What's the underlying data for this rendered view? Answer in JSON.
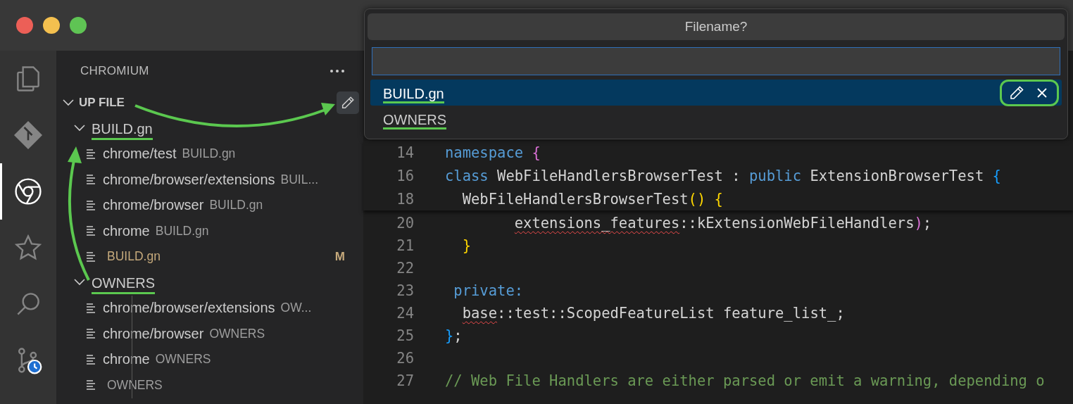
{
  "activity_bar": {
    "items": [
      {
        "kind": "files",
        "selected": false
      },
      {
        "kind": "git",
        "selected": false
      },
      {
        "kind": "chrome",
        "selected": true
      },
      {
        "kind": "star",
        "selected": false
      },
      {
        "kind": "search",
        "selected": false
      },
      {
        "kind": "history",
        "selected": false
      }
    ]
  },
  "sidebar": {
    "title": "CHROMIUM",
    "section": {
      "title": "UP FILE",
      "expanded": true
    },
    "groups": [
      {
        "label": "BUILD.gn",
        "expanded": true,
        "highlighted": true,
        "children": [
          {
            "name": "chrome/test",
            "description": "BUILD.gn"
          },
          {
            "name": "chrome/browser/extensions",
            "description": "BUIL..."
          },
          {
            "name": "chrome/browser",
            "description": "BUILD.gn"
          },
          {
            "name": "chrome",
            "description": "BUILD.gn"
          },
          {
            "description": "BUILD.gn",
            "status": "M"
          }
        ]
      },
      {
        "label": "OWNERS",
        "expanded": true,
        "highlighted": true,
        "children": [
          {
            "name": "chrome/browser/extensions",
            "description": "OW..."
          },
          {
            "name": "chrome/browser",
            "description": "OWNERS"
          },
          {
            "name": "chrome",
            "description": "OWNERS"
          },
          {
            "description": "OWNERS"
          }
        ]
      }
    ]
  },
  "quick_pick": {
    "title": "Filename?",
    "items": [
      {
        "label": "BUILD.gn",
        "selected": true,
        "highlighted": true
      },
      {
        "label": "OWNERS",
        "selected": false,
        "highlighted": true
      }
    ]
  },
  "editor": {
    "sticky_lines": [
      {
        "number": "14",
        "tokens": [
          {
            "kind": "keyword",
            "text": "namespace "
          },
          {
            "kind": "bracket2",
            "text": "{"
          }
        ]
      },
      {
        "number": "16",
        "tokens": [
          {
            "kind": "keyword",
            "text": "class "
          },
          {
            "kind": "plain",
            "text": "WebFileHandlersBrowserTest : "
          },
          {
            "kind": "keyword",
            "text": "public "
          },
          {
            "kind": "plain",
            "text": "ExtensionBrowserTest "
          },
          {
            "kind": "bracket3",
            "text": "{"
          }
        ]
      },
      {
        "number": "18",
        "tokens": [
          {
            "kind": "plain",
            "text": "  WebFileHandlersBrowserTest"
          },
          {
            "kind": "bracket1",
            "text": "() {"
          }
        ]
      }
    ],
    "lines": [
      {
        "number": "20",
        "tokens": [
          {
            "kind": "plain",
            "text": "        extensions_features",
            "error": true
          },
          {
            "kind": "plain",
            "text": "::kExtensionWebFileHandlers"
          },
          {
            "kind": "bracket2",
            "text": ")"
          },
          {
            "kind": "plain",
            "text": ";"
          }
        ]
      },
      {
        "number": "21",
        "tokens": [
          {
            "kind": "bracket1",
            "text": "  }"
          }
        ]
      },
      {
        "number": "22"
      },
      {
        "number": "23",
        "tokens": [
          {
            "kind": "keyword",
            "text": " private:"
          }
        ]
      },
      {
        "number": "24",
        "tokens": [
          {
            "kind": "plain",
            "text": "  base",
            "error": true
          },
          {
            "kind": "plain",
            "text": "::test::ScopedFeatureList feature_list_;"
          }
        ]
      },
      {
        "number": "25",
        "tokens": [
          {
            "kind": "bracket3",
            "text": "}"
          },
          {
            "kind": "plain",
            "text": ";"
          }
        ]
      },
      {
        "number": "26"
      },
      {
        "number": "27",
        "tokens": [
          {
            "kind": "comment",
            "text": "// Web File Handlers are either parsed or emit a warning, depending o"
          }
        ]
      }
    ]
  }
}
